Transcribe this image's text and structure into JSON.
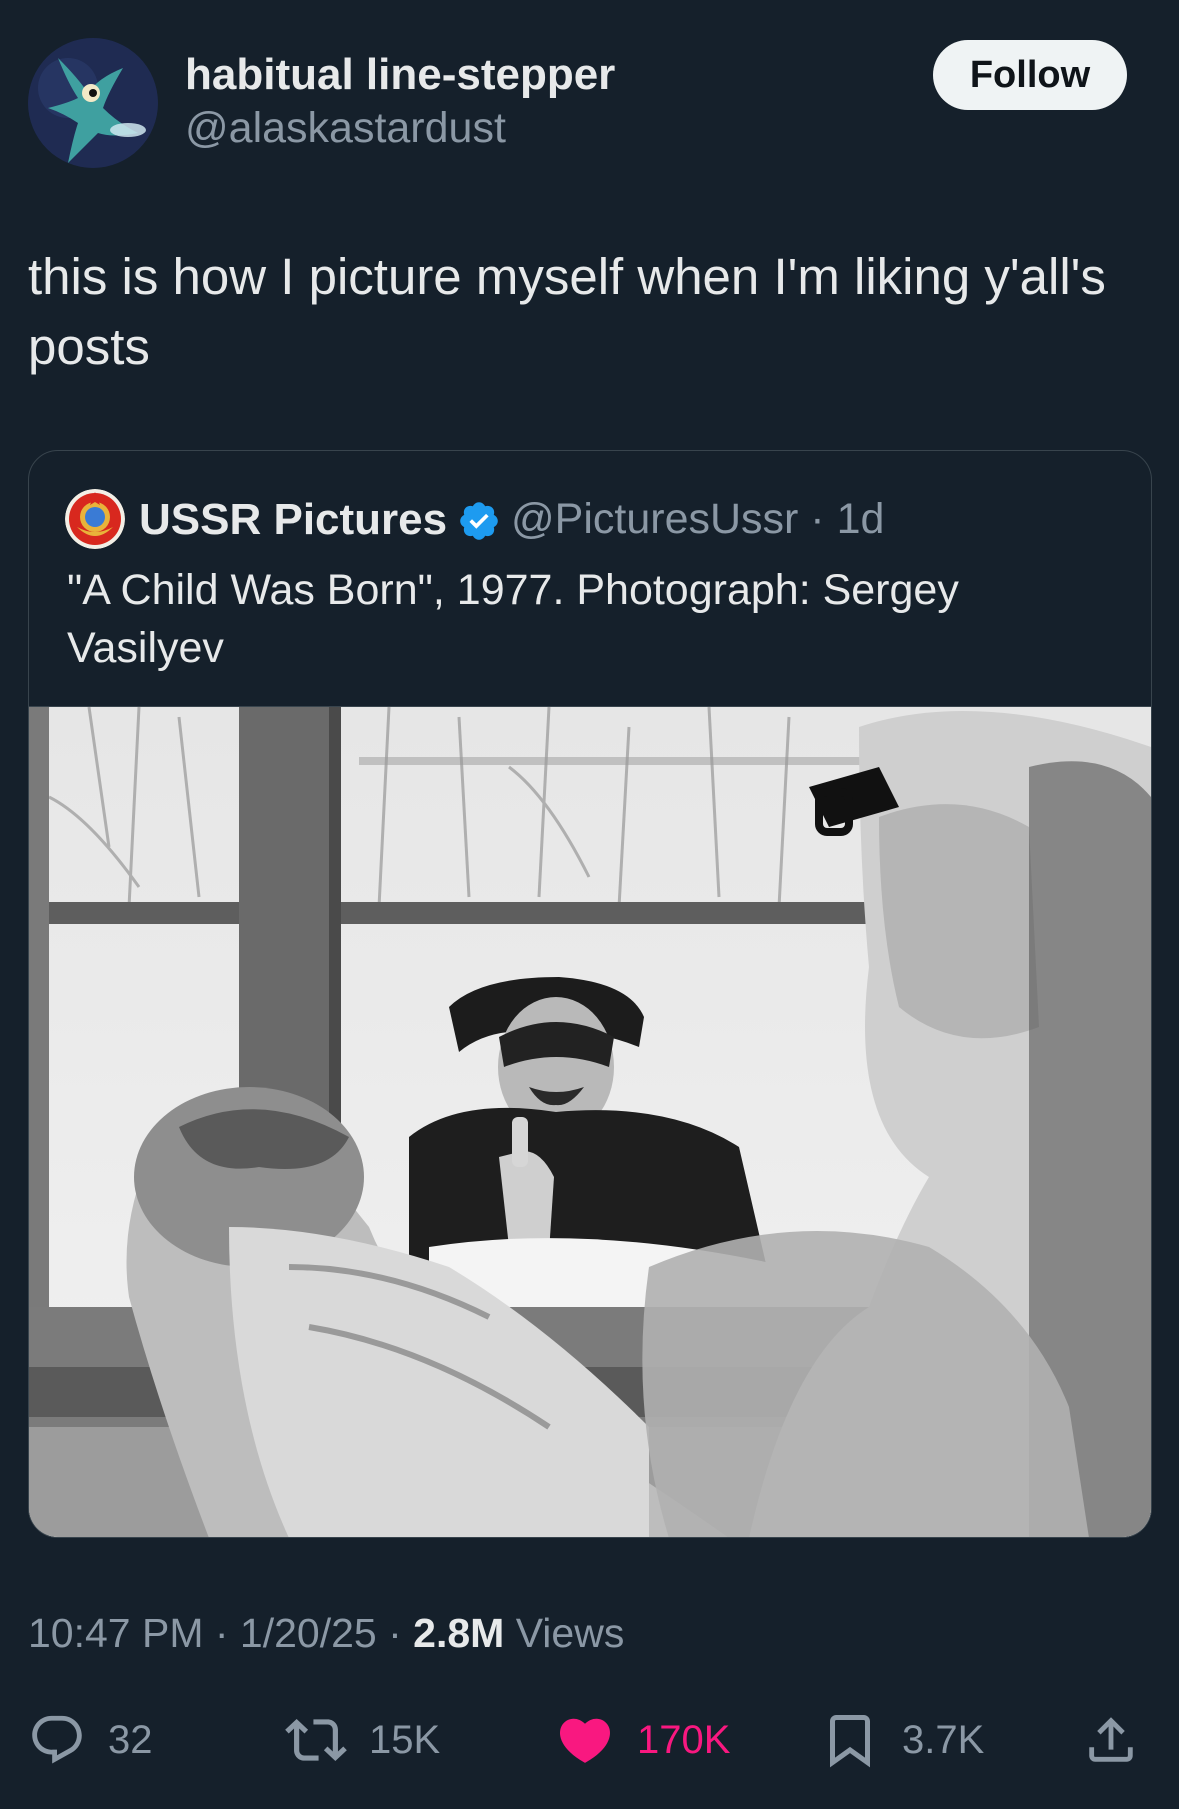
{
  "author": {
    "display_name": "habitual line-stepper",
    "handle": "@alaskastardust",
    "follow_label": "Follow"
  },
  "tweet": {
    "text": "this is how I picture myself when I'm liking y'all's posts"
  },
  "quoted_tweet": {
    "display_name": "USSR Pictures",
    "handle_time": "@PicturesUssr · 1d",
    "text": "\"A Child Was Born\", 1977. Photograph: Sergey Vasilyev",
    "verified": true
  },
  "meta": {
    "time_date": "10:47 PM · 1/20/25 · ",
    "views_count": "2.8M",
    "views_label": " Views"
  },
  "actions": {
    "replies": "32",
    "reposts": "15K",
    "likes": "170K",
    "bookmarks": "3.7K"
  },
  "colors": {
    "background": "#15202b",
    "text": "#e7e9ea",
    "secondary_text": "#8b98a5",
    "like": "#f91880",
    "verified": "#1d9bf0"
  }
}
